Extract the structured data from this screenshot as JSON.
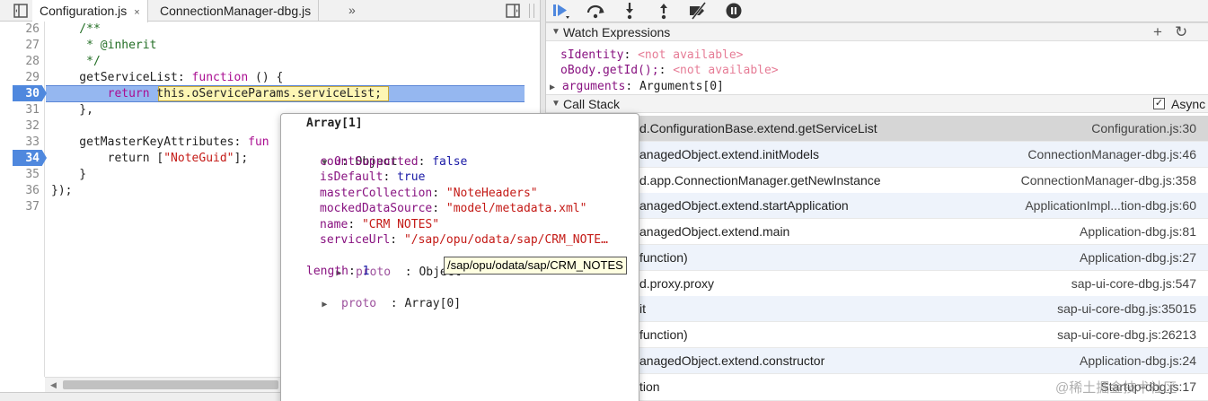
{
  "tabs": [
    {
      "label": "Configuration.js",
      "active": true,
      "close": "×"
    },
    {
      "label": "ConnectionManager-dbg.js",
      "active": false
    }
  ],
  "tab_more": "»",
  "code_lines": [
    {
      "num": "26",
      "text": "    /**"
    },
    {
      "num": "27",
      "text": "     * @inherit"
    },
    {
      "num": "28",
      "text": "     */"
    },
    {
      "num": "29",
      "text_parts": [
        "    getServiceList: ",
        "function",
        " () {"
      ]
    },
    {
      "num": "30",
      "breakpoint": true,
      "text_parts": [
        "        ",
        "return",
        " ",
        "this.oServiceParams.serviceList",
        ";"
      ]
    },
    {
      "num": "31",
      "text": "    },"
    },
    {
      "num": "32",
      "text": ""
    },
    {
      "num": "33",
      "text_parts": [
        "    getMasterKeyAttributes: ",
        "fun"
      ]
    },
    {
      "num": "34",
      "breakpoint": true,
      "text_parts": [
        "        return [",
        "\"NoteGuid\"",
        "];"
      ]
    },
    {
      "num": "35",
      "text": "    }"
    },
    {
      "num": "36",
      "text": "});"
    },
    {
      "num": "37",
      "text": ""
    }
  ],
  "popover": {
    "title": "Array[1]",
    "item0_label": "0",
    "item0_type": "Object",
    "props": [
      {
        "key": "countSupported",
        "value": "false",
        "kind": "bool"
      },
      {
        "key": "isDefault",
        "value": "true",
        "kind": "bool"
      },
      {
        "key": "masterCollection",
        "value": "\"NoteHeaders\"",
        "kind": "str"
      },
      {
        "key": "mockedDataSource",
        "value": "\"model/metadata.xml\"",
        "kind": "str"
      },
      {
        "key": "name",
        "value": "\"CRM NOTES\"",
        "kind": "str"
      },
      {
        "key": "serviceUrl",
        "value": "\"/sap/opu/odata/sap/CRM_NOTE…",
        "kind": "str"
      }
    ],
    "proto_label": "proto",
    "proto_value": "Object",
    "length_key": "length",
    "length_value": "1",
    "array_proto_label": "proto",
    "array_proto_value": "Array[0]"
  },
  "tooltip": "/sap/opu/odata/sap/CRM_NOTES",
  "watch": {
    "title": "Watch Expressions",
    "add": "+",
    "refresh": "↻",
    "items": [
      {
        "name": "sIdentity",
        "value": "<not available>"
      },
      {
        "name": "oBody.getId();",
        "value": "<not available>"
      }
    ],
    "arguments_name": "arguments",
    "arguments_value": "Arguments[0]"
  },
  "call_stack": {
    "title": "Call Stack",
    "async_label": "Async",
    "async_checked": true,
    "frames": [
      {
        "fn": "d.ConfigurationBase.extend.getServiceList",
        "loc": "Configuration.js:30",
        "selected": true
      },
      {
        "fn": "anagedObject.extend.initModels",
        "loc": "ConnectionManager-dbg.js:46"
      },
      {
        "fn": "d.app.ConnectionManager.getNewInstance",
        "loc": "ConnectionManager-dbg.js:358"
      },
      {
        "fn": "anagedObject.extend.startApplication",
        "loc": "ApplicationImpl...tion-dbg.js:60"
      },
      {
        "fn": "anagedObject.extend.main",
        "loc": "Application-dbg.js:81"
      },
      {
        "fn": "function)",
        "loc": "Application-dbg.js:27"
      },
      {
        "fn": "d.proxy.proxy",
        "loc": "sap-ui-core-dbg.js:547"
      },
      {
        "fn": "it",
        "loc": "sap-ui-core-dbg.js:35015"
      },
      {
        "fn": "function)",
        "loc": "sap-ui-core-dbg.js:26213"
      },
      {
        "fn": "anagedObject.extend.constructor",
        "loc": "Application-dbg.js:24"
      },
      {
        "fn": "tion",
        "loc": "Startup-dbg.js:17"
      }
    ]
  },
  "watermark": "@稀土掘金技术社区",
  "colors": {
    "accent": "#4f88de",
    "exec_line": "#95b7f0",
    "keyword": "#aa0d91",
    "string": "#c41a16"
  }
}
